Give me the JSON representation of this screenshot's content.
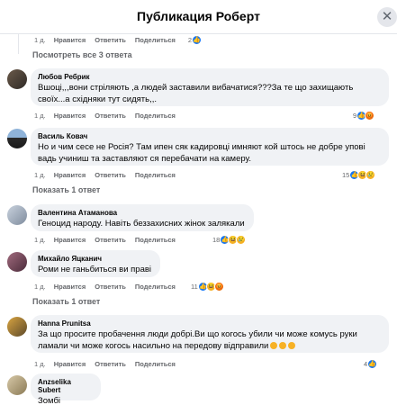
{
  "header": {
    "title": "Публикация Роберт",
    "close_icon": "close-icon"
  },
  "top_reply_meta": {
    "time": "1 д.",
    "like": "Нравится",
    "reply": "Ответить",
    "share": "Поделиться",
    "count": "2"
  },
  "show_more_replies": "Посмотреть все 3 ответа",
  "comments": [
    {
      "author": "Любов Ребрик",
      "text": "Вшоці,,,вони стріляють ,а людей заставили вибачатися???За те що захищають своїх...а східняки тут сидять,,.",
      "time": "1 д.",
      "like": "Нравится",
      "reply": "Ответить",
      "share": "Поделиться",
      "count": "9",
      "reactions": [
        "like",
        "angry"
      ]
    },
    {
      "author": "Василь Ковач",
      "text": "Но и чим сесе не Росія? Там ипен сяк кадировці имняют кой штось не добре упові вадь учиниш та заставляют ся перебачати на камеру.",
      "time": "1 д.",
      "like": "Нравится",
      "reply": "Ответить",
      "share": "Поделиться",
      "count": "15",
      "reactions": [
        "like",
        "haha",
        "sad"
      ],
      "show_replies": "Показать 1 ответ"
    },
    {
      "author": "Валентина Атаманова",
      "text": "Геноцид народу. Навіть беззахисних жінок залякали",
      "time": "1 д.",
      "like": "Нравится",
      "reply": "Ответить",
      "share": "Поделиться",
      "count": "18",
      "reactions": [
        "like",
        "haha",
        "sad"
      ]
    },
    {
      "author": "Михайло Яцканич",
      "text": "Роми не ганьбиться ви праві",
      "time": "1 д.",
      "like": "Нравится",
      "reply": "Ответить",
      "share": "Поделиться",
      "count": "11",
      "reactions": [
        "like",
        "haha",
        "angry"
      ],
      "show_replies": "Показать 1 ответ"
    },
    {
      "author": "Hanna Prunitsa",
      "text": "За що просите пробачення люди добрі.Ви що когось убили чи може комусь руки ламали чи може когось насильно на передову відправили",
      "time": "1 д.",
      "like": "Нравится",
      "reply": "Ответить",
      "share": "Поделиться",
      "count": "4",
      "reactions": [
        "like"
      ]
    },
    {
      "author": "Anzselika Subert",
      "text": "Зомбі"
    }
  ],
  "colors": {
    "like": "#1877f2",
    "haha": "#f7b125",
    "angry": "#e9710f",
    "bubble": "#f0f2f5",
    "meta": "#65676b"
  }
}
